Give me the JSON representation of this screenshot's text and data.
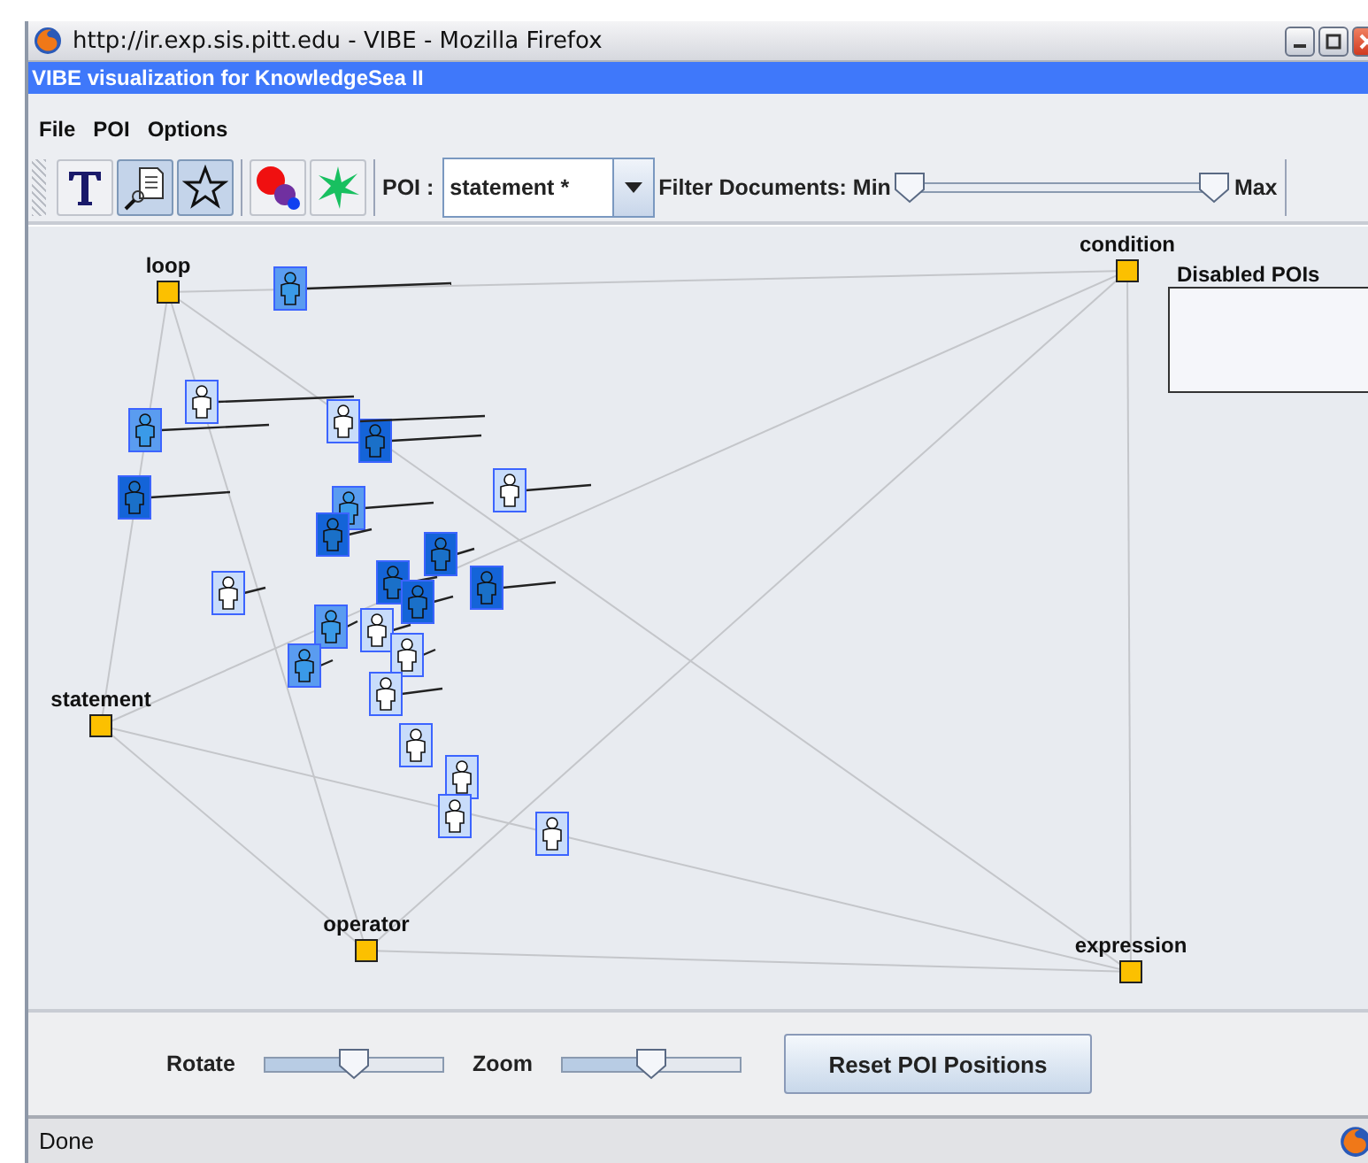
{
  "browser_window": {
    "title": "http://ir.exp.sis.pitt.edu - VIBE - Mozilla Firefox"
  },
  "app_title": "VIBE visualization for KnowledgeSea II",
  "menu": [
    "File",
    "POI",
    "Options"
  ],
  "tools": [
    {
      "kind": "text",
      "selected": false
    },
    {
      "kind": "document",
      "selected": true
    },
    {
      "kind": "star",
      "selected": true
    },
    {
      "kind": "circles",
      "selected": false
    },
    {
      "kind": "burst",
      "selected": false
    }
  ],
  "poi_picker": {
    "label": "POI :",
    "value": "statement *"
  },
  "filter": {
    "label": "Filter Documents: Min",
    "max_label": "Max",
    "thumbs": [
      {
        "level": 0
      },
      {
        "level": 1
      }
    ]
  },
  "pois": [
    {
      "label": "loop"
    },
    {
      "label": "condition"
    },
    {
      "label": "statement"
    },
    {
      "label": "operator"
    },
    {
      "label": "expression"
    }
  ],
  "documents": [
    {
      "color": "#5a9cf0"
    },
    {
      "color": "#c8dcfa"
    },
    {
      "color": "#5a9cf0"
    },
    {
      "color": "#1464d8"
    },
    {
      "color": "#c8dcfa"
    },
    {
      "color": "#1464d8"
    },
    {
      "color": "#c8dcfa"
    },
    {
      "color": "#5a9cf0"
    },
    {
      "color": "#1464d8"
    },
    {
      "color": "#1464d8"
    },
    {
      "color": "#1464d8"
    },
    {
      "color": "#1464d8"
    },
    {
      "color": "#1464d8"
    },
    {
      "color": "#c8dcfa"
    },
    {
      "color": "#5a9cf0"
    },
    {
      "color": "#c8dcfa"
    },
    {
      "color": "#c8dcfa"
    },
    {
      "color": "#5a9cf0"
    },
    {
      "color": "#c8dcfa"
    },
    {
      "color": "#c8dcfa"
    },
    {
      "color": "#c8dcfa"
    },
    {
      "color": "#c8dcfa"
    },
    {
      "color": "#c8dcfa"
    }
  ],
  "disabled_pois": {
    "title": "Disabled POIs"
  },
  "controls": {
    "rotate": {
      "label": "Rotate",
      "level": 0.5
    },
    "zoom": {
      "label": "Zoom",
      "level": 0.5
    },
    "reset_button": "Reset POI Positions"
  },
  "status_bar": "Done"
}
